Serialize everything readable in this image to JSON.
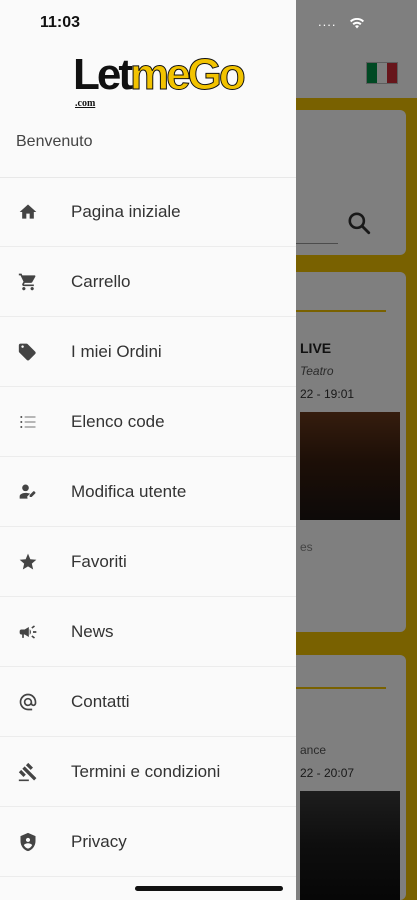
{
  "status_bar": {
    "time": "11:03",
    "signal_text": "....",
    "wifi_icon": "wifi-icon"
  },
  "app": {
    "logo_text_black": "Let",
    "logo_text_yellow": "me",
    "logo_text_go": "Go",
    "logo_subtext": ".com"
  },
  "drawer": {
    "welcome": "Benvenuto",
    "items": [
      {
        "label": "Pagina iniziale",
        "icon": "home-icon"
      },
      {
        "label": "Carrello",
        "icon": "cart-icon"
      },
      {
        "label": "I miei Ordini",
        "icon": "tags-icon"
      },
      {
        "label": "Elenco code",
        "icon": "list-icon"
      },
      {
        "label": "Modifica utente",
        "icon": "user-edit-icon"
      },
      {
        "label": "Favoriti",
        "icon": "star-icon"
      },
      {
        "label": "News",
        "icon": "megaphone-icon"
      },
      {
        "label": "Contatti",
        "icon": "at-icon"
      },
      {
        "label": "Termini e condizioni",
        "icon": "gavel-icon"
      },
      {
        "label": "Privacy",
        "icon": "shield-icon"
      }
    ]
  },
  "background": {
    "flag_colors": [
      "#009246",
      "#ffffff",
      "#ce2b37"
    ],
    "event1": {
      "title": "LIVE",
      "venue": "Teatro",
      "date": "22 - 19:01",
      "tag": "es"
    },
    "event2": {
      "venue": "ance",
      "date": "22 - 20:07"
    }
  },
  "colors": {
    "accent": "#f2c300",
    "drawer_bg": "#fafafa",
    "text": "#333333"
  }
}
